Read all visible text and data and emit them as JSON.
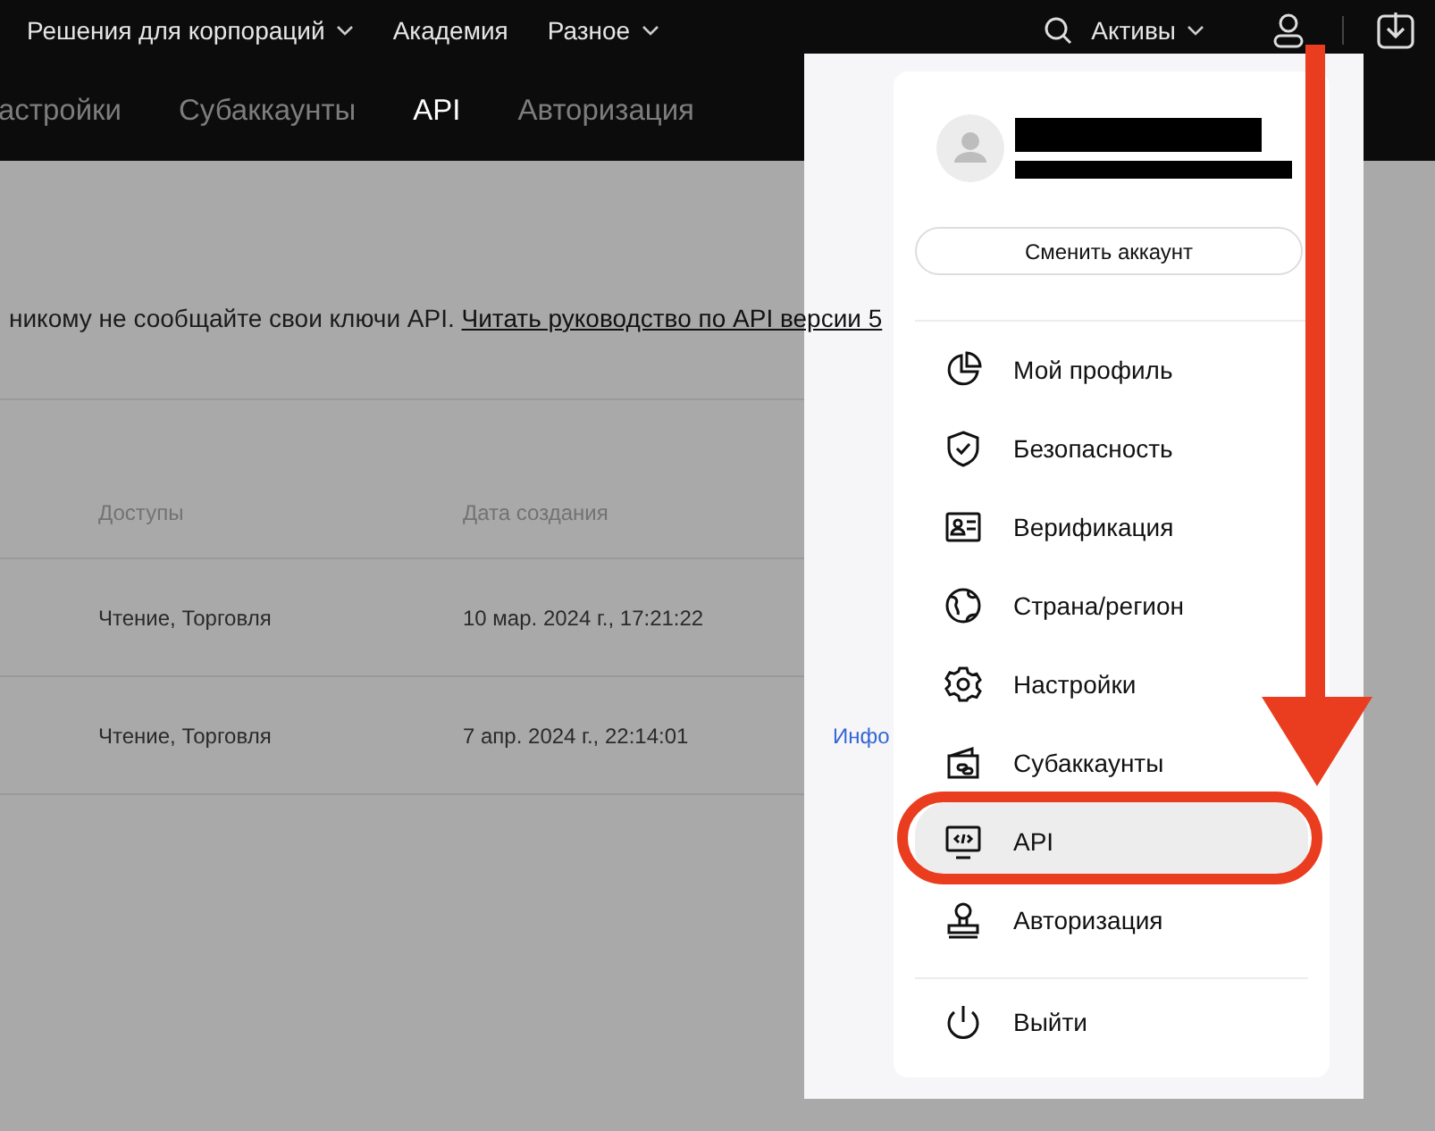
{
  "top_nav": {
    "left": [
      {
        "label": "Решения для корпораций",
        "dropdown": true
      },
      {
        "label": "Академия",
        "dropdown": false
      },
      {
        "label": "Разное",
        "dropdown": true
      }
    ],
    "assets": {
      "label": "Активы",
      "dropdown": true
    }
  },
  "tabs": [
    {
      "label": "астройки",
      "selected": false
    },
    {
      "label": "Субаккаунты",
      "selected": false
    },
    {
      "label": "API",
      "selected": true
    },
    {
      "label": "Авторизация",
      "selected": false
    }
  ],
  "notice": {
    "text": "никому не сообщайте свои ключи API.",
    "link": "Читать руководство по API версии 5"
  },
  "table": {
    "columns": [
      "Доступы",
      "Дата создания"
    ],
    "rows": [
      {
        "access": "Чтение, Торговля",
        "created": "10 мар. 2024 г., 17:21:22"
      },
      {
        "access": "Чтение, Торговля",
        "created": "7 апр. 2024 г., 22:14:01",
        "action": "Инфо"
      }
    ]
  },
  "account_menu": {
    "switch_button": "Сменить аккаунт",
    "items": [
      {
        "label": "Мой профиль",
        "selected": false
      },
      {
        "label": "Безопасность",
        "selected": false
      },
      {
        "label": "Верификация",
        "selected": false
      },
      {
        "label": "Страна/регион",
        "selected": false
      },
      {
        "label": "Настройки",
        "selected": false
      },
      {
        "label": "Субаккаунты",
        "selected": false
      },
      {
        "label": "API",
        "selected": true
      },
      {
        "label": "Авторизация",
        "selected": false
      }
    ],
    "logout": "Выйти"
  }
}
